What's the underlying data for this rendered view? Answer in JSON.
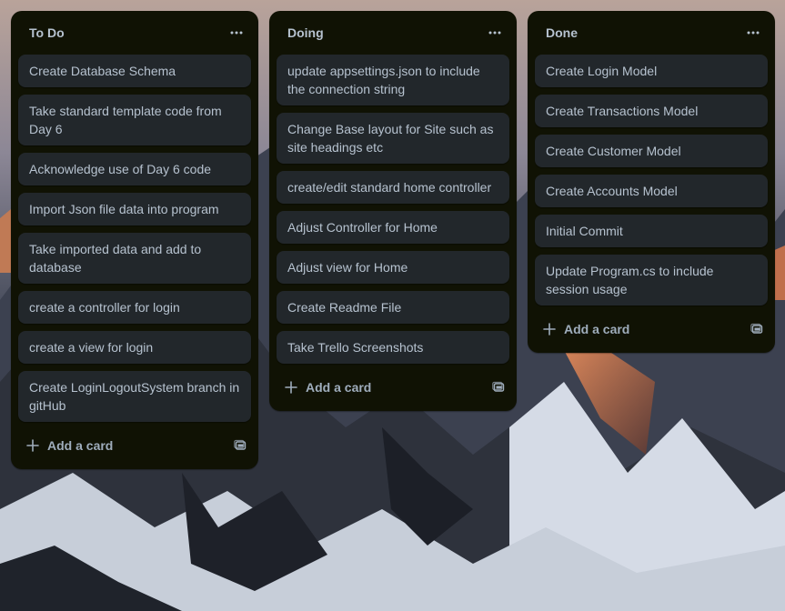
{
  "colors": {
    "list_bg": "#101204",
    "card_bg": "#22272b",
    "text": "#b6c2cf",
    "muted_text": "#9fadbc"
  },
  "lists": [
    {
      "title": "To Do",
      "cards": [
        "Create Database Schema",
        "Take standard template code from Day 6",
        "Acknowledge use of Day 6 code",
        "Import Json file data into program",
        "Take imported data and add to database",
        "create a controller for login",
        "create a view for login",
        "Create LoginLogoutSystem branch in gitHub"
      ],
      "add_card_label": "Add a card"
    },
    {
      "title": "Doing",
      "cards": [
        "update appsettings.json to include the connection string",
        "Change Base layout for Site such as site headings etc",
        "create/edit standard home controller",
        "Adjust Controller for Home",
        "Adjust view for Home",
        "Create Readme File",
        "Take Trello Screenshots"
      ],
      "add_card_label": "Add a card"
    },
    {
      "title": "Done",
      "cards": [
        "Create Login Model",
        "Create Transactions Model",
        "Create Customer Model",
        "Create Accounts Model",
        "Initial Commit",
        "Update Program.cs to include session usage"
      ],
      "add_card_label": "Add a card"
    }
  ],
  "icons": {
    "list_menu": "ellipsis-icon",
    "add_card": "plus-icon",
    "create_from_template": "template-icon"
  }
}
